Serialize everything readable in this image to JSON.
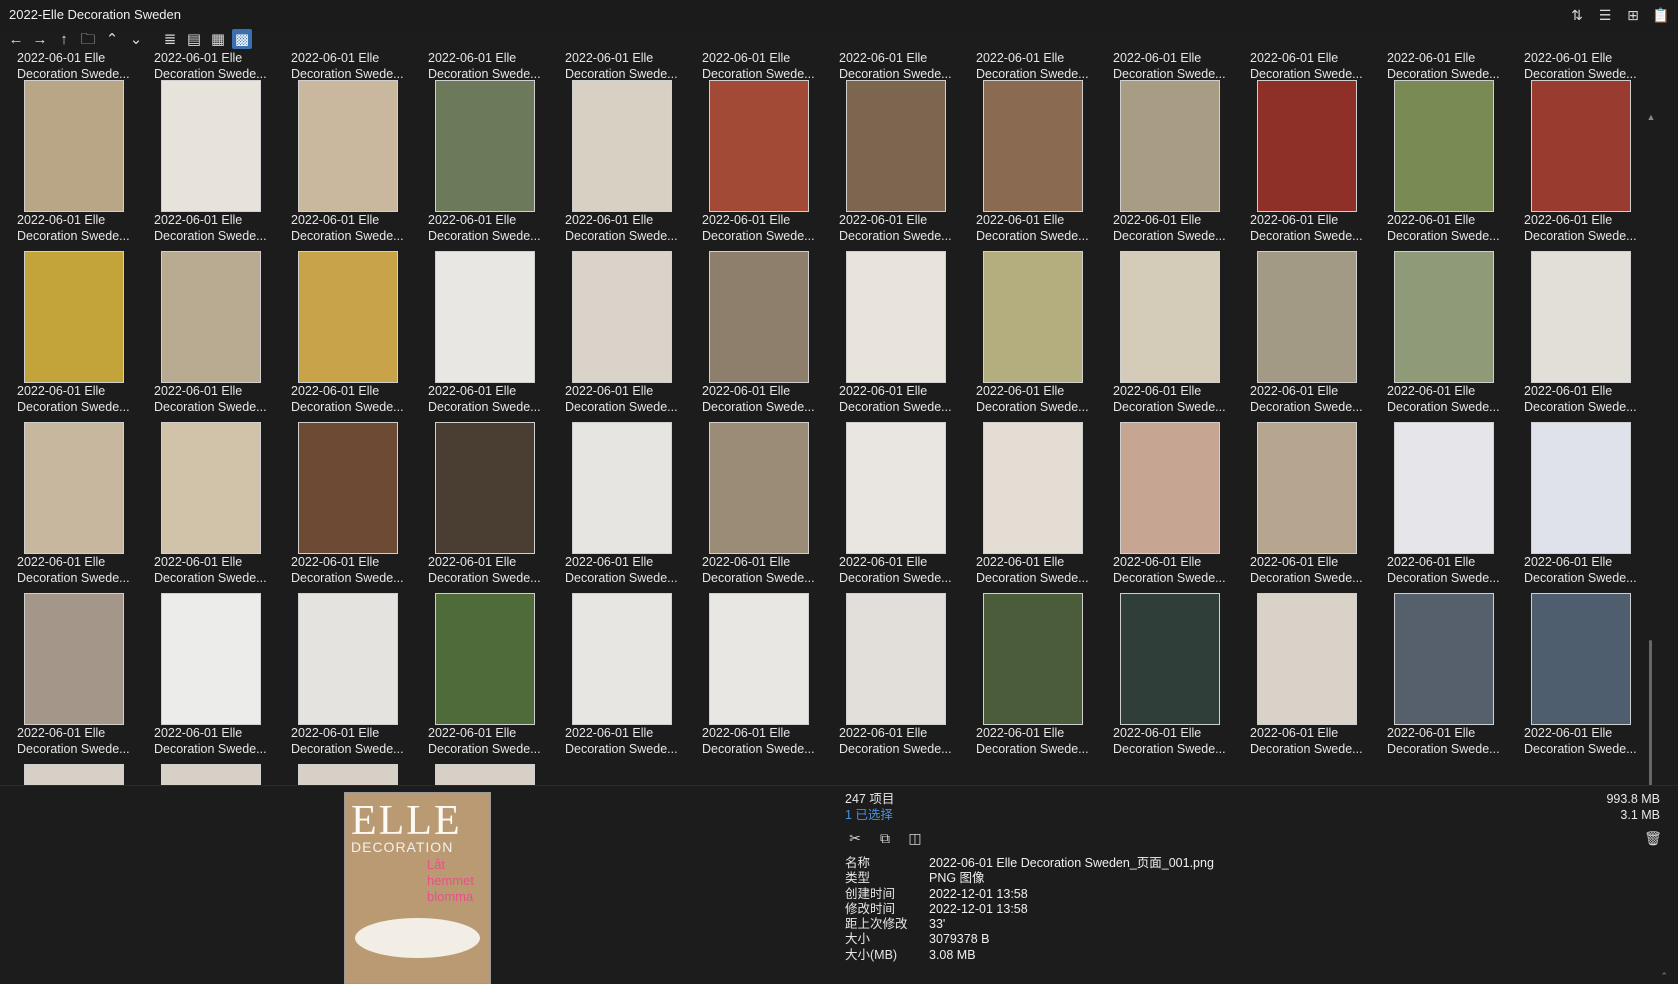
{
  "window": {
    "title": "2022-Elle Decoration Sweden"
  },
  "window_icons": [
    "sort-icon",
    "details-view-icon",
    "add-pane-icon",
    "clipboard-icon"
  ],
  "toolbar": {
    "icons": [
      "back-arrow-icon",
      "forward-arrow-icon",
      "up-arrow-icon",
      "new-folder-icon",
      "chevron-up-icon",
      "chevron-down-icon",
      "list-view-icon",
      "details-list-icon",
      "tiles-view-icon",
      "thumbnails-view-icon"
    ]
  },
  "caption": {
    "line1": "2022-06-01 Elle",
    "line2": "Decoration Swede..."
  },
  "thumbnails": {
    "rows": 5,
    "columns": 12,
    "colors": [
      [
        "#b8a687",
        "#e8e3da",
        "#c9b79e",
        "#6c7a5b",
        "#d8d0c2",
        "#a24a35",
        "#7d6650",
        "#8a6b52",
        "#a99c85",
        "#8f3028",
        "#7a8a55",
        "#9a3b2f"
      ],
      [
        "#c2a43a",
        "#b9ab92",
        "#c9a34a",
        "#e9e7e3",
        "#d9d3c9",
        "#8d7f6c",
        "#e8e4dc",
        "#b4ad7d",
        "#d4cbb9",
        "#a39a86",
        "#8f9a78",
        "#e2ded8"
      ],
      [
        "#c7b79f",
        "#d0c3aa",
        "#6d4a33",
        "#4a3d32",
        "#e7e5e1",
        "#9b8c77",
        "#e9e6e1",
        "#e4ddd3",
        "#c6a592",
        "#b6a690",
        "#e6e5ea",
        "#dfe2ea"
      ],
      [
        "#a49789",
        "#ececea",
        "#e5e3df",
        "#4f6b3a",
        "#e8e6e3",
        "#e9e7e3",
        "#e2dfda",
        "#4b5c3b",
        "#2f3e39",
        "#d8d2c9",
        "#56606c",
        "#4e5e6e"
      ]
    ]
  },
  "footer": {
    "item_count": "247 项目",
    "selected": "1 已选择",
    "total_size": "993.8 MB",
    "selected_size": "3.1 MB",
    "action_icons": [
      "cut-icon",
      "copy-icon",
      "copy-path-icon"
    ],
    "props": [
      {
        "k": "名称",
        "v": "2022-06-01 Elle Decoration Sweden_页面_001.png"
      },
      {
        "k": "类型",
        "v": "PNG 图像"
      },
      {
        "k": "创建时间",
        "v": "2022-12-01  13:58"
      },
      {
        "k": "修改时间",
        "v": "2022-12-01  13:58"
      },
      {
        "k": "距上次修改",
        "v": "33'"
      },
      {
        "k": "大小",
        "v": "3079378 B"
      },
      {
        "k": "大小(MB)",
        "v": "3.08 MB"
      }
    ],
    "preview": {
      "brand": "ELLE",
      "sub": "DECORATION",
      "pink": "Låt hemmet blomma"
    }
  }
}
